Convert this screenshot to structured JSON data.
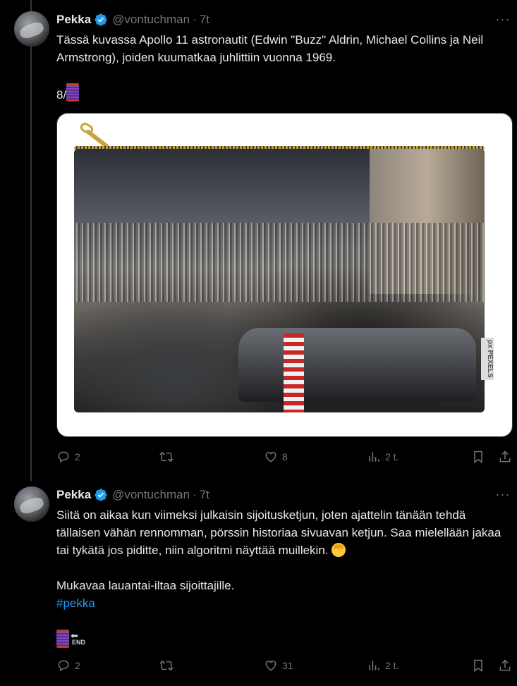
{
  "tweets": [
    {
      "name": "Pekka",
      "handle": "@vontuchman",
      "time": "7t",
      "more": "···",
      "text": "Tässä kuvassa Apollo 11 astronautit (Edwin \"Buzz\" Aldrin, Michael Collins ja Neil Armstrong), joiden kuumatkaa juhlittiin vuonna 1969.",
      "thread_marker": "8/",
      "image_watermark": "px PEXELS",
      "actions": {
        "replies": "2",
        "retweets": "",
        "likes": "8",
        "views": "2 t."
      }
    },
    {
      "name": "Pekka",
      "handle": "@vontuchman",
      "time": "7t",
      "more": "···",
      "text": "Siitä on aikaa kun viimeksi julkaisin sijoitusketjun, joten ajattelin tänään tehdä tällaisen vähän rennomman, pörssin historiaa sivuavan ketjun. Saa mielellään jakaa tai tykätä jos piditte, niin algoritmi näyttää muillekin.",
      "text2": "Mukavaa lauantai-iltaa sijoittajille.",
      "hashtag": "#pekka",
      "end_label": "END",
      "actions": {
        "replies": "2",
        "retweets": "",
        "likes": "31",
        "views": "2 t."
      }
    }
  ],
  "colors": {
    "background": "#000000",
    "text": "#e7e9ea",
    "muted": "#71767b",
    "link": "#1d9bf0",
    "verified": "#1d9bf0"
  },
  "icons": [
    "verified-badge-icon",
    "more-icon",
    "reply-icon",
    "retweet-icon",
    "like-icon",
    "views-icon",
    "bookmark-icon",
    "share-icon"
  ]
}
